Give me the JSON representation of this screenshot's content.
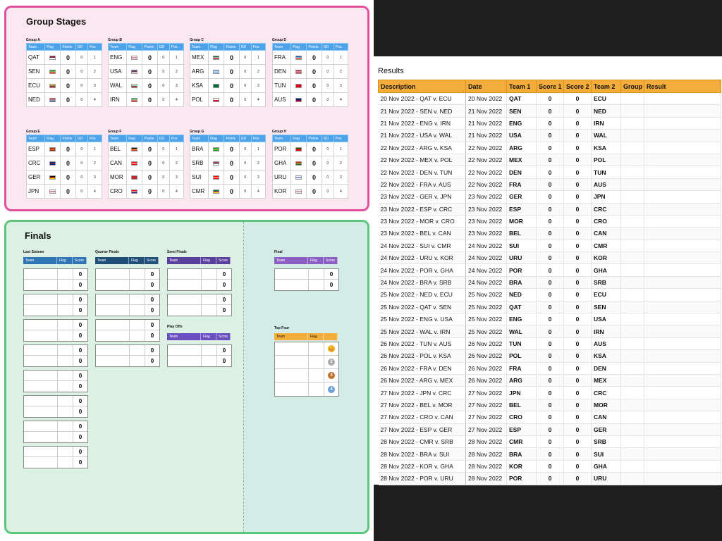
{
  "group_stages": {
    "title": "Group Stages",
    "headers": [
      "Team",
      "Flag",
      "Points",
      "GD",
      "Pos."
    ],
    "groups": [
      {
        "label": "Group A",
        "rows": [
          {
            "team": "QAT",
            "points": "0",
            "gd": "0",
            "pos": "1",
            "flag_colors": [
              "#8a1538",
              "#ffffff"
            ]
          },
          {
            "team": "SEN",
            "points": "0",
            "gd": "0",
            "pos": "2",
            "flag_colors": [
              "#00853f",
              "#fdef42",
              "#e31b23"
            ]
          },
          {
            "team": "ECU",
            "points": "0",
            "gd": "0",
            "pos": "3",
            "flag_colors": [
              "#ffd100",
              "#034ea2",
              "#ed1c24"
            ]
          },
          {
            "team": "NED",
            "points": "0",
            "gd": "0",
            "pos": "4",
            "flag_colors": [
              "#ae1c28",
              "#ffffff",
              "#21468b"
            ]
          }
        ]
      },
      {
        "label": "Group B",
        "rows": [
          {
            "team": "ENG",
            "points": "0",
            "gd": "0",
            "pos": "1",
            "flag_colors": [
              "#ffffff",
              "#cf142b",
              "#ffffff"
            ]
          },
          {
            "team": "USA",
            "points": "0",
            "gd": "0",
            "pos": "2",
            "flag_colors": [
              "#3c3b6e",
              "#b22234",
              "#ffffff"
            ]
          },
          {
            "team": "WAL",
            "points": "0",
            "gd": "0",
            "pos": "3",
            "flag_colors": [
              "#ffffff",
              "#00b140",
              "#d30731"
            ]
          },
          {
            "team": "IRN",
            "points": "0",
            "gd": "0",
            "pos": "4",
            "flag_colors": [
              "#239f40",
              "#ffffff",
              "#da0000"
            ]
          }
        ]
      },
      {
        "label": "Group C",
        "rows": [
          {
            "team": "MEX",
            "points": "0",
            "gd": "0",
            "pos": "1",
            "flag_colors": [
              "#006847",
              "#ffffff",
              "#ce1126"
            ]
          },
          {
            "team": "ARG",
            "points": "0",
            "gd": "0",
            "pos": "2",
            "flag_colors": [
              "#74acdf",
              "#ffffff",
              "#74acdf"
            ]
          },
          {
            "team": "KSA",
            "points": "0",
            "gd": "0",
            "pos": "3",
            "flag_colors": [
              "#006c35",
              "#006c35",
              "#006c35"
            ]
          },
          {
            "team": "POL",
            "points": "0",
            "gd": "0",
            "pos": "4",
            "flag_colors": [
              "#ffffff",
              "#dc143c"
            ]
          }
        ]
      },
      {
        "label": "Group D",
        "rows": [
          {
            "team": "FRA",
            "points": "0",
            "gd": "0",
            "pos": "1",
            "flag_colors": [
              "#0055a4",
              "#ffffff",
              "#ef4135"
            ]
          },
          {
            "team": "DEN",
            "points": "0",
            "gd": "0",
            "pos": "2",
            "flag_colors": [
              "#c8102e",
              "#ffffff",
              "#c8102e"
            ]
          },
          {
            "team": "TUN",
            "points": "0",
            "gd": "0",
            "pos": "3",
            "flag_colors": [
              "#e70013",
              "#e70013",
              "#e70013"
            ]
          },
          {
            "team": "AUS",
            "points": "0",
            "gd": "0",
            "pos": "4",
            "flag_colors": [
              "#012169",
              "#012169",
              "#e4002b"
            ]
          }
        ]
      },
      {
        "label": "Group E",
        "rows": [
          {
            "team": "ESP",
            "points": "0",
            "gd": "0",
            "pos": "1",
            "flag_colors": [
              "#aa151b",
              "#f1bf00",
              "#aa151b"
            ]
          },
          {
            "team": "CRC",
            "points": "0",
            "gd": "0",
            "pos": "2",
            "flag_colors": [
              "#002b7f",
              "#ce1126",
              "#002b7f"
            ]
          },
          {
            "team": "GER",
            "points": "0",
            "gd": "0",
            "pos": "3",
            "flag_colors": [
              "#000000",
              "#dd0000",
              "#ffce00"
            ]
          },
          {
            "team": "JPN",
            "points": "0",
            "gd": "0",
            "pos": "4",
            "flag_colors": [
              "#ffffff",
              "#bc002d",
              "#ffffff"
            ]
          }
        ]
      },
      {
        "label": "Group F",
        "rows": [
          {
            "team": "BEL",
            "points": "0",
            "gd": "0",
            "pos": "1",
            "flag_colors": [
              "#000000",
              "#fdda24",
              "#ef3340"
            ]
          },
          {
            "team": "CAN",
            "points": "0",
            "gd": "0",
            "pos": "2",
            "flag_colors": [
              "#ff0000",
              "#ffffff",
              "#ff0000"
            ]
          },
          {
            "team": "MOR",
            "points": "0",
            "gd": "0",
            "pos": "3",
            "flag_colors": [
              "#c1272d",
              "#c1272d",
              "#c1272d"
            ]
          },
          {
            "team": "CRO",
            "points": "0",
            "gd": "0",
            "pos": "4",
            "flag_colors": [
              "#ff0000",
              "#ffffff",
              "#171796"
            ]
          }
        ]
      },
      {
        "label": "Group G",
        "rows": [
          {
            "team": "BRA",
            "points": "0",
            "gd": "0",
            "pos": "1",
            "flag_colors": [
              "#009c3b",
              "#ffdf00",
              "#009c3b"
            ]
          },
          {
            "team": "SRB",
            "points": "0",
            "gd": "0",
            "pos": "2",
            "flag_colors": [
              "#c6363c",
              "#0c4076",
              "#ffffff"
            ]
          },
          {
            "team": "SUI",
            "points": "0",
            "gd": "0",
            "pos": "3",
            "flag_colors": [
              "#ff0000",
              "#ffffff",
              "#ff0000"
            ]
          },
          {
            "team": "CMR",
            "points": "0",
            "gd": "0",
            "pos": "4",
            "flag_colors": [
              "#007a5e",
              "#ce1126",
              "#fcd116"
            ]
          }
        ]
      },
      {
        "label": "Group H",
        "rows": [
          {
            "team": "POR",
            "points": "0",
            "gd": "0",
            "pos": "1",
            "flag_colors": [
              "#006600",
              "#ff0000",
              "#ff0000"
            ]
          },
          {
            "team": "GHA",
            "points": "0",
            "gd": "0",
            "pos": "2",
            "flag_colors": [
              "#ce1126",
              "#fcd116",
              "#006b3f"
            ]
          },
          {
            "team": "URU",
            "points": "0",
            "gd": "0",
            "pos": "3",
            "flag_colors": [
              "#ffffff",
              "#0038a8",
              "#ffffff"
            ]
          },
          {
            "team": "KOR",
            "points": "0",
            "gd": "0",
            "pos": "4",
            "flag_colors": [
              "#ffffff",
              "#cd2e3a",
              "#ffffff"
            ]
          }
        ]
      }
    ]
  },
  "finals": {
    "title": "Finals",
    "ko_headers": [
      "Team",
      "Flag",
      "Score"
    ],
    "top_four_headers": [
      "Team",
      "Flag"
    ],
    "colors": {
      "last_sixteen": "#2f75b5",
      "quarter": "#1f4e79",
      "semi": "#5b3f9e",
      "playoff": "#6a4fc1",
      "final": "#8b5ec4",
      "top_four": "#f2ad3a"
    },
    "last_sixteen": {
      "label": "Last Sixteen",
      "matches": [
        [
          "0",
          "0"
        ],
        [
          "0",
          "0"
        ],
        [
          "0",
          "0"
        ],
        [
          "0",
          "0"
        ],
        [
          "0",
          "0"
        ],
        [
          "0",
          "0"
        ],
        [
          "0",
          "0"
        ],
        [
          "0",
          "0"
        ]
      ]
    },
    "quarter_finals": {
      "label": "Quarter Finals",
      "matches": [
        [
          "0",
          "0"
        ],
        [
          "0",
          "0"
        ],
        [
          "0",
          "0"
        ],
        [
          "0",
          "0"
        ]
      ]
    },
    "semi_finals": {
      "label": "Semi Finals",
      "matches": [
        [
          "0",
          "0"
        ],
        [
          "0",
          "0"
        ]
      ]
    },
    "play_offs": {
      "label": "Play Offs",
      "matches": [
        [
          "0",
          "0"
        ]
      ]
    },
    "final": {
      "label": "Final",
      "matches": [
        [
          "0",
          "0"
        ]
      ]
    },
    "top_four": {
      "label": "Top Four",
      "medals": [
        {
          "icon": "trophy-icon",
          "glyph": "🏆",
          "color": "#e6a817"
        },
        {
          "icon": "silver-medal-icon",
          "glyph": "2",
          "color": "#a8a8a8"
        },
        {
          "icon": "bronze-medal-icon",
          "glyph": "3",
          "color": "#c0702a"
        },
        {
          "icon": "fourth-place-icon",
          "glyph": "4",
          "color": "#6aa0d8"
        }
      ]
    }
  },
  "results": {
    "title": "Results",
    "headers": [
      "Description",
      "Date",
      "Team 1",
      "Score 1",
      "Score 2",
      "Team 2",
      "Group",
      "Result"
    ],
    "rows": [
      {
        "description": "20 Nov 2022 - QAT v. ECU",
        "date": "20 Nov 2022",
        "team1": "QAT",
        "score1": "0",
        "score2": "0",
        "team2": "ECU"
      },
      {
        "description": "21 Nov 2022 - SEN v. NED",
        "date": "21 Nov 2022",
        "team1": "SEN",
        "score1": "0",
        "score2": "0",
        "team2": "NED"
      },
      {
        "description": "21 Nov 2022 - ENG v. IRN",
        "date": "21 Nov 2022",
        "team1": "ENG",
        "score1": "0",
        "score2": "0",
        "team2": "IRN"
      },
      {
        "description": "21 Nov 2022 - USA v. WAL",
        "date": "21 Nov 2022",
        "team1": "USA",
        "score1": "0",
        "score2": "0",
        "team2": "WAL"
      },
      {
        "description": "22 Nov 2022 - ARG v. KSA",
        "date": "22 Nov 2022",
        "team1": "ARG",
        "score1": "0",
        "score2": "0",
        "team2": "KSA"
      },
      {
        "description": "22 Nov 2022 - MEX v. POL",
        "date": "22 Nov 2022",
        "team1": "MEX",
        "score1": "0",
        "score2": "0",
        "team2": "POL"
      },
      {
        "description": "22 Nov 2022 - DEN v. TUN",
        "date": "22 Nov 2022",
        "team1": "DEN",
        "score1": "0",
        "score2": "0",
        "team2": "TUN"
      },
      {
        "description": "22 Nov 2022 - FRA v. AUS",
        "date": "22 Nov 2022",
        "team1": "FRA",
        "score1": "0",
        "score2": "0",
        "team2": "AUS"
      },
      {
        "description": "23 Nov 2022 - GER v. JPN",
        "date": "23 Nov 2022",
        "team1": "GER",
        "score1": "0",
        "score2": "0",
        "team2": "JPN"
      },
      {
        "description": "23 Nov 2022 - ESP v. CRC",
        "date": "23 Nov 2022",
        "team1": "ESP",
        "score1": "0",
        "score2": "0",
        "team2": "CRC"
      },
      {
        "description": "23 Nov 2022 - MOR v. CRO",
        "date": "23 Nov 2022",
        "team1": "MOR",
        "score1": "0",
        "score2": "0",
        "team2": "CRO"
      },
      {
        "description": "23 Nov 2022 - BEL v. CAN",
        "date": "23 Nov 2022",
        "team1": "BEL",
        "score1": "0",
        "score2": "0",
        "team2": "CAN"
      },
      {
        "description": "24 Nov 2022 - SUI v. CMR",
        "date": "24 Nov 2022",
        "team1": "SUI",
        "score1": "0",
        "score2": "0",
        "team2": "CMR"
      },
      {
        "description": "24 Nov 2022 - URU v. KOR",
        "date": "24 Nov 2022",
        "team1": "URU",
        "score1": "0",
        "score2": "0",
        "team2": "KOR"
      },
      {
        "description": "24 Nov 2022 - POR v. GHA",
        "date": "24 Nov 2022",
        "team1": "POR",
        "score1": "0",
        "score2": "0",
        "team2": "GHA"
      },
      {
        "description": "24 Nov 2022 - BRA v. SRB",
        "date": "24 Nov 2022",
        "team1": "BRA",
        "score1": "0",
        "score2": "0",
        "team2": "SRB"
      },
      {
        "description": "25 Nov 2022 - NED v. ECU",
        "date": "25 Nov 2022",
        "team1": "NED",
        "score1": "0",
        "score2": "0",
        "team2": "ECU"
      },
      {
        "description": "25 Nov 2022 - QAT v. SEN",
        "date": "25 Nov 2022",
        "team1": "QAT",
        "score1": "0",
        "score2": "0",
        "team2": "SEN"
      },
      {
        "description": "25 Nov 2022 - ENG v. USA",
        "date": "25 Nov 2022",
        "team1": "ENG",
        "score1": "0",
        "score2": "0",
        "team2": "USA"
      },
      {
        "description": "25 Nov 2022 - WAL v. IRN",
        "date": "25 Nov 2022",
        "team1": "WAL",
        "score1": "0",
        "score2": "0",
        "team2": "IRN"
      },
      {
        "description": "26 Nov 2022 - TUN v. AUS",
        "date": "26 Nov 2022",
        "team1": "TUN",
        "score1": "0",
        "score2": "0",
        "team2": "AUS"
      },
      {
        "description": "26 Nov 2022 - POL v. KSA",
        "date": "26 Nov 2022",
        "team1": "POL",
        "score1": "0",
        "score2": "0",
        "team2": "KSA"
      },
      {
        "description": "26 Nov 2022 - FRA v. DEN",
        "date": "26 Nov 2022",
        "team1": "FRA",
        "score1": "0",
        "score2": "0",
        "team2": "DEN"
      },
      {
        "description": "26 Nov 2022 - ARG v. MEX",
        "date": "26 Nov 2022",
        "team1": "ARG",
        "score1": "0",
        "score2": "0",
        "team2": "MEX"
      },
      {
        "description": "27 Nov 2022 - JPN v. CRC",
        "date": "27 Nov 2022",
        "team1": "JPN",
        "score1": "0",
        "score2": "0",
        "team2": "CRC"
      },
      {
        "description": "27 Nov 2022 - BEL v. MOR",
        "date": "27 Nov 2022",
        "team1": "BEL",
        "score1": "0",
        "score2": "0",
        "team2": "MOR"
      },
      {
        "description": "27 Nov 2022 - CRO v. CAN",
        "date": "27 Nov 2022",
        "team1": "CRO",
        "score1": "0",
        "score2": "0",
        "team2": "CAN"
      },
      {
        "description": "27 Nov 2022 - ESP v. GER",
        "date": "27 Nov 2022",
        "team1": "ESP",
        "score1": "0",
        "score2": "0",
        "team2": "GER"
      },
      {
        "description": "28 Nov 2022 - CMR v. SRB",
        "date": "28 Nov 2022",
        "team1": "CMR",
        "score1": "0",
        "score2": "0",
        "team2": "SRB"
      },
      {
        "description": "28 Nov 2022 - BRA v. SUI",
        "date": "28 Nov 2022",
        "team1": "BRA",
        "score1": "0",
        "score2": "0",
        "team2": "SUI"
      },
      {
        "description": "28 Nov 2022 - KOR v. GHA",
        "date": "28 Nov 2022",
        "team1": "KOR",
        "score1": "0",
        "score2": "0",
        "team2": "GHA"
      },
      {
        "description": "28 Nov 2022 - POR v. URU",
        "date": "28 Nov 2022",
        "team1": "POR",
        "score1": "0",
        "score2": "0",
        "team2": "URU"
      }
    ]
  }
}
